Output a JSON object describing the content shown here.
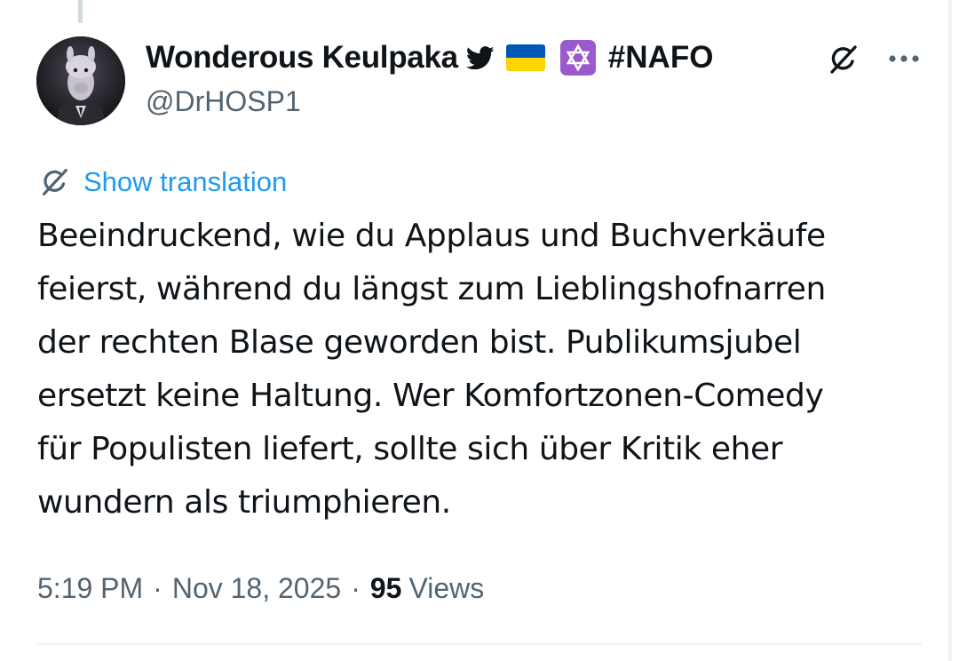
{
  "author": {
    "display_name": "Wonderous Keulpaka",
    "handle": "@DrHOSP1",
    "tag": "#NAFO",
    "badges": [
      "bird-icon",
      "ukraine-flag-icon",
      "star-of-david-icon"
    ]
  },
  "header": {
    "grok_icon": "grok-icon",
    "more_icon": "more-icon"
  },
  "translate": {
    "icon": "grok-icon",
    "label": "Show translation"
  },
  "tweet": {
    "lines": [
      "Beeindruckend, wie du Applaus und Buchverkäufe",
      "feierst, während du längst zum Lieblingshofnarren",
      "der rechten Blase geworden bist. Publikumsjubel",
      "ersetzt keine Haltung. Wer Komfortzonen-Comedy",
      "für Populisten liefert, sollte sich über Kritik eher",
      "wundern als triumphieren."
    ]
  },
  "meta": {
    "time": "5:19 PM",
    "separator": "·",
    "date": "Nov 18, 2025",
    "views_count": "95",
    "views_label": "Views"
  },
  "colors": {
    "text": "#0f1419",
    "secondary": "#536471",
    "link": "#1d9bf0",
    "divider": "#eff3f4",
    "flag_blue": "#0057b7",
    "flag_yellow": "#ffd700",
    "star_bg": "#9b59d0"
  }
}
